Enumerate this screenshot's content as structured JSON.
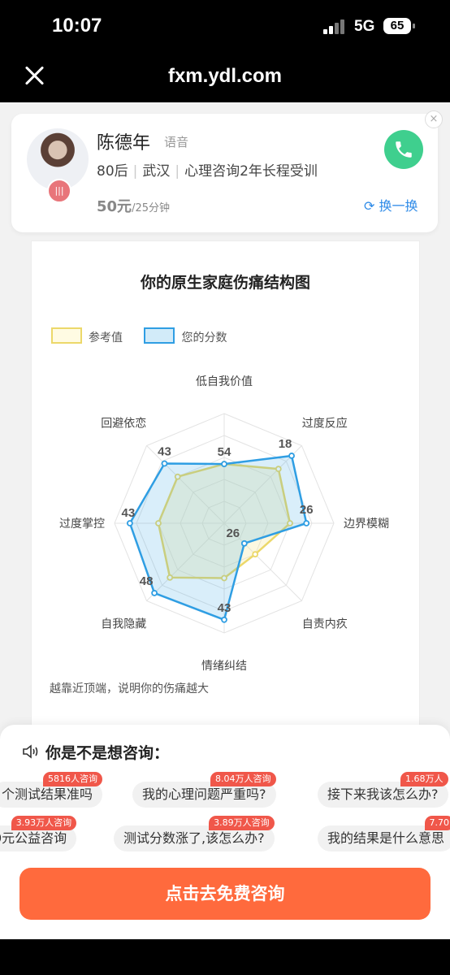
{
  "status": {
    "time": "10:07",
    "network": "5G",
    "battery": "65"
  },
  "nav": {
    "url": "fxm.ydl.com"
  },
  "counselor": {
    "name": "陈德年",
    "mode": "语音",
    "age": "80后",
    "city": "武汉",
    "training": "心理咨询2年长程受训",
    "price": "50元",
    "price_unit": "/25分钟",
    "swap_label": "换一换"
  },
  "chart_data": {
    "type": "radar",
    "title": "你的原生家庭伤痛结构图",
    "axes": [
      "低自我价值",
      "过度反应",
      "边界模糊",
      "自责内疚",
      "情绪纠结",
      "自我隐藏",
      "过度掌控",
      "回避依恋"
    ],
    "series": [
      {
        "name": "参考值",
        "values": [
          54,
          70,
          60,
          40,
          50,
          70,
          60,
          60
        ],
        "color": "#ecd86a"
      },
      {
        "name": "您的分数",
        "values": [
          54,
          87,
          75,
          26,
          88,
          90,
          86,
          77
        ],
        "color": "#2f9ee3"
      }
    ],
    "point_labels": [
      "54",
      "18",
      "26",
      "26",
      "43",
      "48",
      "43",
      "43"
    ],
    "max": 100,
    "note": "越靠近顶端，说明你的伤痛越大"
  },
  "sheet": {
    "title": "你是不是想咨询：",
    "chips": [
      {
        "text": "个测试结果准吗",
        "badge": "5816人咨询"
      },
      {
        "text": "我的心理问题严重吗?",
        "badge": "8.04万人咨询"
      },
      {
        "text": "接下来我该怎么办?",
        "badge": "1.68万人"
      },
      {
        "text": "0元公益咨询",
        "badge": "3.93万人咨询"
      },
      {
        "text": "测试分数涨了,该怎么办?",
        "badge": "3.89万人咨询"
      },
      {
        "text": "我的结果是什么意思",
        "badge": "7.70"
      }
    ],
    "cta": "点击去免费咨询"
  }
}
